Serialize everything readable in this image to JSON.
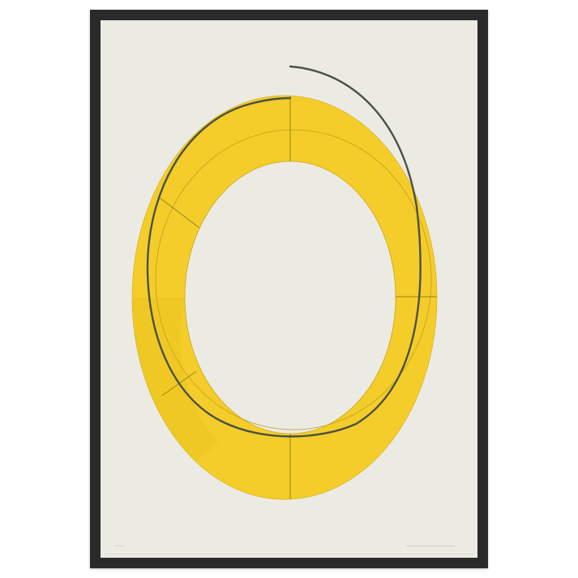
{
  "artwork": {
    "background_color": "#ecebe3",
    "frame_color": "#2a2a2a",
    "ring_fill_color": "#f4cd2a",
    "ring_line_color": "#b89b1e",
    "arc_stroke_color": "#4a5246"
  }
}
